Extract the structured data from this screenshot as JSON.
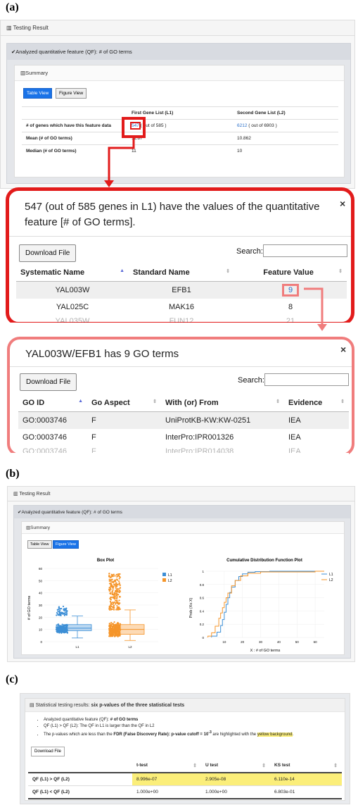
{
  "labels": {
    "a": "(a)",
    "b": "(b)",
    "c": "(c)"
  },
  "a": {
    "card_title": "Testing Result",
    "panel_title": "Analyzed quantitative feature (QF): # of GO terms",
    "summary_title": "Summary",
    "btn_table": "Table View",
    "btn_figure": "Figure View",
    "col_l1": "First Gene List (L1)",
    "col_l2": "Second Gene List (L2)",
    "rows": [
      {
        "label": "# of genes which have this feature data",
        "l1_link": "547",
        "l1_rest": "( out of 585 )",
        "l2_link": "6212",
        "l2_rest": "( out of 6903 )"
      },
      {
        "label": "Mean (# of GO terms)",
        "l1": "11.87",
        "l2": "10.862"
      },
      {
        "label": "Median (# of GO terms)",
        "l1": "11",
        "l2": "10"
      }
    ]
  },
  "modal1": {
    "title": "547 (out of 585 genes in L1) have the values of the quantitative feature [# of GO terms].",
    "close": "×",
    "download": "Download File",
    "search": "Search:",
    "headers": [
      "Systematic Name",
      "Standard Name",
      "Feature Value"
    ],
    "rows": [
      [
        "YAL003W",
        "EFB1",
        "9"
      ],
      [
        "YAL025C",
        "MAK16",
        "8"
      ],
      [
        "YAL035W",
        "FUN12",
        "21"
      ]
    ]
  },
  "modal2": {
    "title": "YAL003W/EFB1 has 9 GO terms",
    "close": "×",
    "download": "Download File",
    "search": "Search:",
    "headers": [
      "GO ID",
      "Go Aspect",
      "With (or) From",
      "Evidence"
    ],
    "rows": [
      [
        "GO:0003746",
        "F",
        "UniProtKB-KW:KW-0251",
        "IEA"
      ],
      [
        "GO:0003746",
        "F",
        "InterPro:IPR001326",
        "IEA"
      ],
      [
        "GO:0003746",
        "F",
        "InterPro:IPR014038",
        "IEA"
      ]
    ]
  },
  "b": {
    "card_title": "Testing Result",
    "panel_title": "Analyzed quantitative feature (QF): # of GO terms",
    "summary_title": "Summary",
    "btn_table": "Table View",
    "btn_figure": "Figure View",
    "box_title": "Box Plot",
    "cdf_title": "Cumulative Distribution Function Plot",
    "box_ylabel": "# of GO terms",
    "cdf_ylabel": "Prob (X≤ X)",
    "cdf_xlabel": "X : # of GO terms",
    "legend": [
      "L1",
      "L2"
    ],
    "colors": {
      "l1": "#3d8fd6",
      "l2": "#f5952a"
    }
  },
  "c": {
    "title_plain": "Statistical testing results:",
    "title_bold": "six p-values of the three statistical tests",
    "bullet1_plain": "Analyzed quantitative feature (QF):",
    "bullet1_bold": "# of GO terms",
    "bullet2": "QF (L1) > QF (L2): The QF in L1 is larger than the QF in L2",
    "bullet3_a": "The p-values which are less than the",
    "bullet3_b": "FDR (False Discovery Rate): p-value cutoff = 10",
    "bullet3_exp": "-3",
    "bullet3_c": "are highlighted with the",
    "bullet3_d": "yellow background",
    "bullet3_e": ".",
    "download": "Download File",
    "headers": [
      "t-test",
      "U test",
      "KS test"
    ],
    "rows": [
      {
        "label": "QF (L1) > QF (L2)",
        "v": [
          "8.996e-07",
          "2.905e-08",
          "6.110e-14"
        ]
      },
      {
        "label": "QF (L1) < QF (L2)",
        "v": [
          "1.000e+00",
          "1.000e+00",
          "6.803e-01"
        ]
      }
    ]
  },
  "chart_data": [
    {
      "type": "box",
      "title": "Box Plot",
      "ylabel": "# of GO terms",
      "categories": [
        "L1",
        "L2"
      ],
      "ylim": [
        0,
        60
      ],
      "yticks": [
        0,
        10,
        20,
        30,
        40,
        50,
        60
      ],
      "series": [
        {
          "name": "L1",
          "min": 3,
          "q1": 9,
          "median": 11,
          "q3": 14,
          "max": 21
        },
        {
          "name": "L2",
          "min": 1,
          "q1": 6,
          "median": 10,
          "q3": 14,
          "max": 26
        }
      ]
    },
    {
      "type": "line",
      "title": "Cumulative Distribution Function Plot",
      "xlabel": "X : # of GO terms",
      "ylabel": "Prob (X≤ X)",
      "xlim": [
        0,
        65
      ],
      "ylim": [
        0,
        1
      ],
      "xticks": [
        10,
        20,
        30,
        40,
        50,
        60
      ],
      "yticks": [
        0,
        0.2,
        0.4,
        0.6,
        0.8,
        1
      ],
      "series": [
        {
          "name": "L1",
          "x": [
            3,
            6,
            8,
            9,
            10,
            11,
            12,
            13,
            14,
            16,
            18,
            20,
            23,
            27,
            35
          ],
          "y": [
            0.02,
            0.08,
            0.18,
            0.27,
            0.38,
            0.5,
            0.6,
            0.68,
            0.76,
            0.86,
            0.92,
            0.96,
            0.985,
            0.995,
            1
          ]
        },
        {
          "name": "L2",
          "x": [
            1,
            3,
            5,
            7,
            8,
            9,
            10,
            11,
            12,
            14,
            16,
            19,
            23,
            30,
            60
          ],
          "y": [
            0.02,
            0.07,
            0.17,
            0.29,
            0.37,
            0.45,
            0.53,
            0.6,
            0.67,
            0.78,
            0.86,
            0.93,
            0.97,
            0.99,
            1
          ]
        }
      ]
    }
  ]
}
